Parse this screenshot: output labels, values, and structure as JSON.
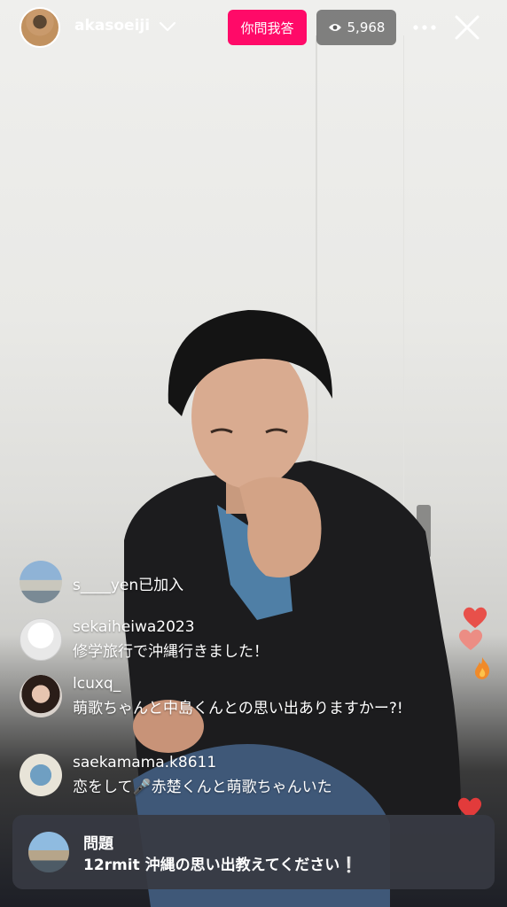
{
  "header": {
    "username": "akasoeiji",
    "qa_button_label": "你問我答",
    "viewer_count": "5,968",
    "icons": [
      "chevron-down-icon",
      "eye-icon",
      "more-icon",
      "close-icon"
    ]
  },
  "comments": [
    {
      "username": "s____yen",
      "text": "已加入",
      "joined": true
    },
    {
      "username": "sekaiheiwa2023",
      "text": "修学旅行で沖縄行きました！"
    },
    {
      "username": "lcuxq_",
      "text": "萌歌ちゃんと中島くんとの思い出ありますかー?!"
    },
    {
      "username": "saekamama.k8611",
      "text": "恋をして🎤赤楚くんと萌歌ちゃんいた"
    }
  ],
  "question_card": {
    "title": "問題",
    "username": "12rmit",
    "text": "沖縄の思い出教えてください❕"
  },
  "colors": {
    "qa_button": "#ff0a68",
    "viewer_badge": "rgba(90,90,90,0.75)",
    "question_card": "#373a42"
  }
}
